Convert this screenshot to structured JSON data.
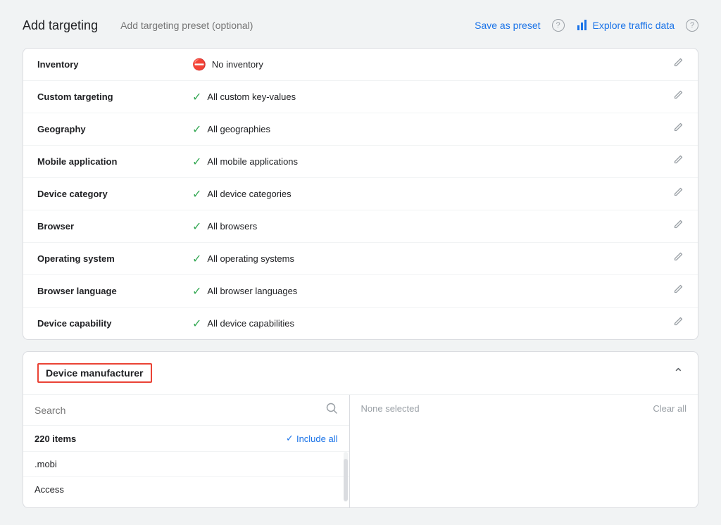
{
  "page": {
    "title": "Add targeting",
    "preset_placeholder": "Add targeting preset (optional)",
    "save_preset_label": "Save as preset",
    "explore_traffic_label": "Explore traffic data"
  },
  "targeting_rows": [
    {
      "label": "Inventory",
      "value": "No inventory",
      "icon": "block",
      "has_edit": true
    },
    {
      "label": "Custom targeting",
      "value": "All custom key-values",
      "icon": "check",
      "has_edit": true
    },
    {
      "label": "Geography",
      "value": "All geographies",
      "icon": "check",
      "has_edit": true
    },
    {
      "label": "Mobile application",
      "value": "All mobile applications",
      "icon": "check",
      "has_edit": true
    },
    {
      "label": "Device category",
      "value": "All device categories",
      "icon": "check",
      "has_edit": true
    },
    {
      "label": "Browser",
      "value": "All browsers",
      "icon": "check",
      "has_edit": true
    },
    {
      "label": "Operating system",
      "value": "All operating systems",
      "icon": "check",
      "has_edit": true
    },
    {
      "label": "Browser language",
      "value": "All browser languages",
      "icon": "check",
      "has_edit": true
    },
    {
      "label": "Device capability",
      "value": "All device capabilities",
      "icon": "check",
      "has_edit": true
    }
  ],
  "device_manufacturer": {
    "section_title": "Device manufacturer",
    "search_placeholder": "Search",
    "items_count": "220 items",
    "include_all_label": "Include all",
    "list_items": [
      ".mobi",
      "Access"
    ],
    "right_panel_empty": "None selected",
    "clear_all_label": "Clear all"
  }
}
